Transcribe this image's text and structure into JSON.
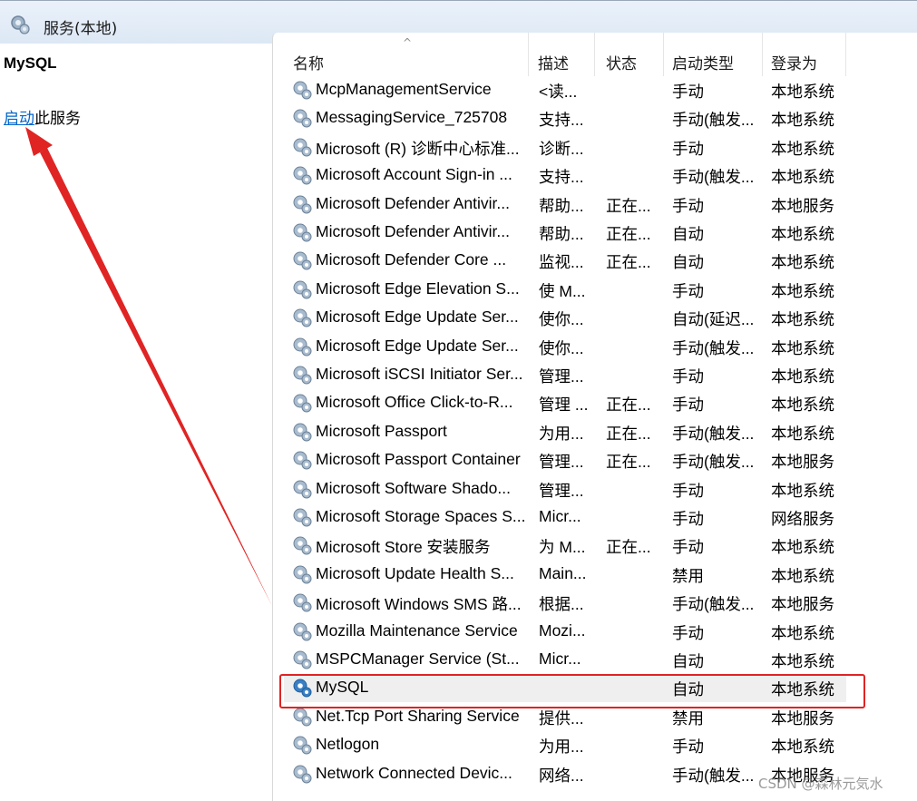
{
  "window": {
    "title": "服务(本地)"
  },
  "left_pane": {
    "service_name": "MySQL",
    "action_link": "启动",
    "action_suffix": "此服务"
  },
  "columns": {
    "name": "名称",
    "description": "描述",
    "status": "状态",
    "startup_type": "启动类型",
    "log_on_as": "登录为",
    "sort_indicator": "^"
  },
  "services": [
    {
      "name": "McpManagementService",
      "desc": "<读...",
      "status": "",
      "start": "手动",
      "logon": "本地系统"
    },
    {
      "name": "MessagingService_725708",
      "desc": "支持...",
      "status": "",
      "start": "手动(触发...",
      "logon": "本地系统"
    },
    {
      "name": "Microsoft (R) 诊断中心标准...",
      "desc": "诊断...",
      "status": "",
      "start": "手动",
      "logon": "本地系统"
    },
    {
      "name": "Microsoft Account Sign-in ...",
      "desc": "支持...",
      "status": "",
      "start": "手动(触发...",
      "logon": "本地系统"
    },
    {
      "name": "Microsoft Defender Antivir...",
      "desc": "帮助...",
      "status": "正在...",
      "start": "手动",
      "logon": "本地服务"
    },
    {
      "name": "Microsoft Defender Antivir...",
      "desc": "帮助...",
      "status": "正在...",
      "start": "自动",
      "logon": "本地系统"
    },
    {
      "name": "Microsoft Defender Core ...",
      "desc": "监视...",
      "status": "正在...",
      "start": "自动",
      "logon": "本地系统"
    },
    {
      "name": "Microsoft Edge Elevation S...",
      "desc": "使 M...",
      "status": "",
      "start": "手动",
      "logon": "本地系统"
    },
    {
      "name": "Microsoft Edge Update Ser...",
      "desc": "使你...",
      "status": "",
      "start": "自动(延迟...",
      "logon": "本地系统"
    },
    {
      "name": "Microsoft Edge Update Ser...",
      "desc": "使你...",
      "status": "",
      "start": "手动(触发...",
      "logon": "本地系统"
    },
    {
      "name": "Microsoft iSCSI Initiator Ser...",
      "desc": "管理...",
      "status": "",
      "start": "手动",
      "logon": "本地系统"
    },
    {
      "name": "Microsoft Office Click-to-R...",
      "desc": "管理 ...",
      "status": "正在...",
      "start": "手动",
      "logon": "本地系统"
    },
    {
      "name": "Microsoft Passport",
      "desc": "为用...",
      "status": "正在...",
      "start": "手动(触发...",
      "logon": "本地系统"
    },
    {
      "name": "Microsoft Passport Container",
      "desc": "管理...",
      "status": "正在...",
      "start": "手动(触发...",
      "logon": "本地服务"
    },
    {
      "name": "Microsoft Software Shado...",
      "desc": "管理...",
      "status": "",
      "start": "手动",
      "logon": "本地系统"
    },
    {
      "name": "Microsoft Storage Spaces S...",
      "desc": "Micr...",
      "status": "",
      "start": "手动",
      "logon": "网络服务"
    },
    {
      "name": "Microsoft Store 安装服务",
      "desc": "为 M...",
      "status": "正在...",
      "start": "手动",
      "logon": "本地系统"
    },
    {
      "name": "Microsoft Update Health S...",
      "desc": "Main...",
      "status": "",
      "start": "禁用",
      "logon": "本地系统"
    },
    {
      "name": "Microsoft Windows SMS 路...",
      "desc": "根据...",
      "status": "",
      "start": "手动(触发...",
      "logon": "本地服务"
    },
    {
      "name": "Mozilla Maintenance Service",
      "desc": "Mozi...",
      "status": "",
      "start": "手动",
      "logon": "本地系统"
    },
    {
      "name": "MSPCManager Service (St...",
      "desc": "Micr...",
      "status": "",
      "start": "自动",
      "logon": "本地系统"
    },
    {
      "name": "MySQL",
      "desc": "",
      "status": "",
      "start": "自动",
      "logon": "本地系统",
      "selected": true
    },
    {
      "name": "Net.Tcp Port Sharing Service",
      "desc": "提供...",
      "status": "",
      "start": "禁用",
      "logon": "本地服务"
    },
    {
      "name": "Netlogon",
      "desc": "为用...",
      "status": "",
      "start": "手动",
      "logon": "本地系统"
    },
    {
      "name": "Network Connected Devic...",
      "desc": "网络...",
      "status": "",
      "start": "手动(触发...",
      "logon": "本地服务"
    }
  ],
  "watermark": "CSDN @森林元気水",
  "colors": {
    "link": "#0066cc",
    "annotation": "#e02424",
    "selected_row": "#efefef"
  }
}
